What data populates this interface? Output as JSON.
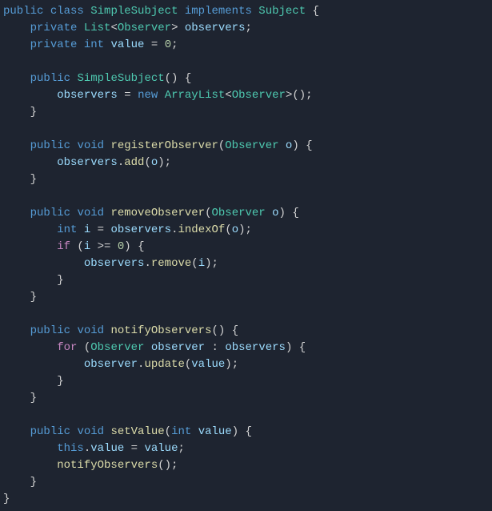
{
  "tokens": {
    "public": "public",
    "class": "class",
    "implements": "implements",
    "private": "private",
    "void": "void",
    "int": "int",
    "new": "new",
    "if": "if",
    "for": "for",
    "this": "this",
    "SimpleSubject": "SimpleSubject",
    "Subject": "Subject",
    "List": "List",
    "Observer": "Observer",
    "ArrayList": "ArrayList",
    "observers": "observers",
    "value": "value",
    "o": "o",
    "i": "i",
    "observer": "observer",
    "zero": "0",
    "registerObserver": "registerObserver",
    "removeObserver": "removeObserver",
    "notifyObservers": "notifyObservers",
    "setValue": "setValue",
    "add": "add",
    "indexOf": "indexOf",
    "remove": "remove",
    "update": "update",
    "gte": ">="
  }
}
